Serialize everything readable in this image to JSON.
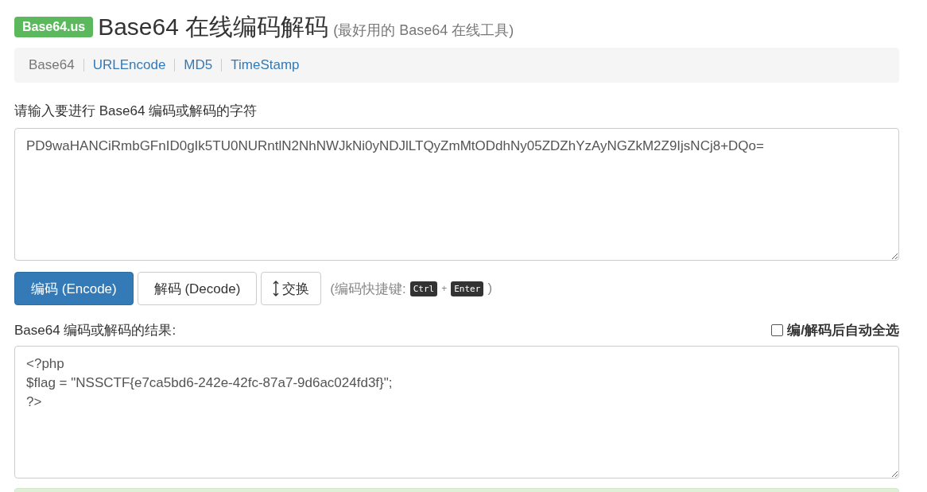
{
  "header": {
    "logo": "Base64.us",
    "title": "Base64 在线编码解码",
    "subtitle": "(最好用的 Base64 在线工具)"
  },
  "nav": [
    {
      "label": "Base64",
      "selected": true
    },
    {
      "label": "URLEncode",
      "selected": false
    },
    {
      "label": "MD5",
      "selected": false
    },
    {
      "label": "TimeStamp",
      "selected": false
    }
  ],
  "input": {
    "label": "请输入要进行 Base64 编码或解码的字符",
    "value": "PD9waHANCiRmbGFnID0gIk5TU0NURntlN2NhNWJkNi0yNDJlLTQyZmMtODdhNy05ZDZhYzAyNGZkM2Z9IjsNCj8+DQo="
  },
  "buttons": [
    {
      "kind": "primary",
      "label": "编码 (Encode)"
    },
    {
      "kind": "default",
      "label": "解码 (Decode)"
    },
    {
      "kind": "swap",
      "label": "交换"
    }
  ],
  "shortcut": {
    "open": "(编码快捷键:",
    "keys": [
      "Ctrl",
      "Enter"
    ],
    "plus": "+",
    "close": ")"
  },
  "output": {
    "label": "Base64 编码或解码的结果:",
    "auto_select": {
      "label": "编/解码后自动全选",
      "checked": false
    },
    "value": "<?php\n$flag = \"NSSCTF{e7ca5bd6-242e-42fc-87a7-9d6ac024fd3f}\";\n?>"
  }
}
